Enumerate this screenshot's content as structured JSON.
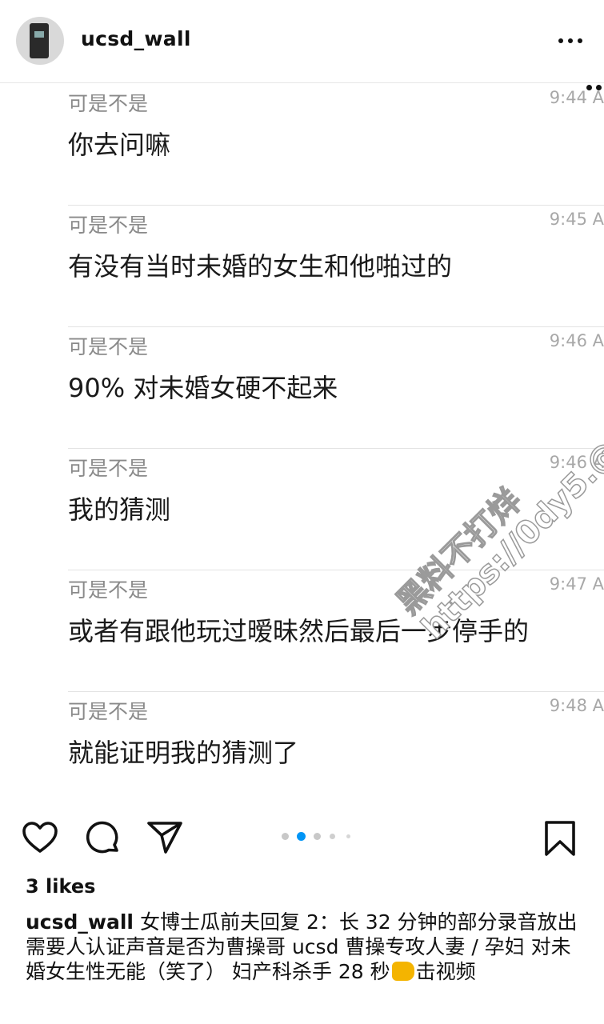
{
  "header": {
    "username": "ucsd_wall",
    "avatar_icon": "door-lock-avatar",
    "more_icon": "more-horizontal-icon"
  },
  "messages": [
    {
      "sender": "可是不是",
      "time": "9:44 A",
      "text": "你去问嘛"
    },
    {
      "sender": "可是不是",
      "time": "9:45 A",
      "text": "有没有当时未婚的女生和他啪过的"
    },
    {
      "sender": "可是不是",
      "time": "9:46 A",
      "text": "90% 对未婚女硬不起来"
    },
    {
      "sender": "可是不是",
      "time": "9:46 A",
      "text": "我的猜测"
    },
    {
      "sender": "可是不是",
      "time": "9:47 A",
      "text": "或者有跟他玩过暧昧然后最后一步停手的"
    },
    {
      "sender": "可是不是",
      "time": "9:48 A",
      "text": "就能证明我的猜测了"
    }
  ],
  "watermark": {
    "line1": "黑料不打烊",
    "line2": "https://0dy5.@"
  },
  "actions": {
    "like_icon": "heart-icon",
    "comment_icon": "comment-icon",
    "share_icon": "send-icon",
    "save_icon": "bookmark-icon",
    "carousel": {
      "total": 5,
      "active": 2
    },
    "accent": "#0095f6"
  },
  "likes": "3 likes",
  "caption": {
    "username": "ucsd_wall",
    "text_before": "女博士瓜前夫回复 2：长 32 分钟的部分录音放出 需要人认证声音是否为曹操哥 ucsd 曹操专攻人妻 / 孕妇 对未婚女生性无能（笑了） 妇产科杀手 28 秒",
    "emoji_icon": "oncoming-fist-emoji",
    "text_after": "击视频"
  }
}
